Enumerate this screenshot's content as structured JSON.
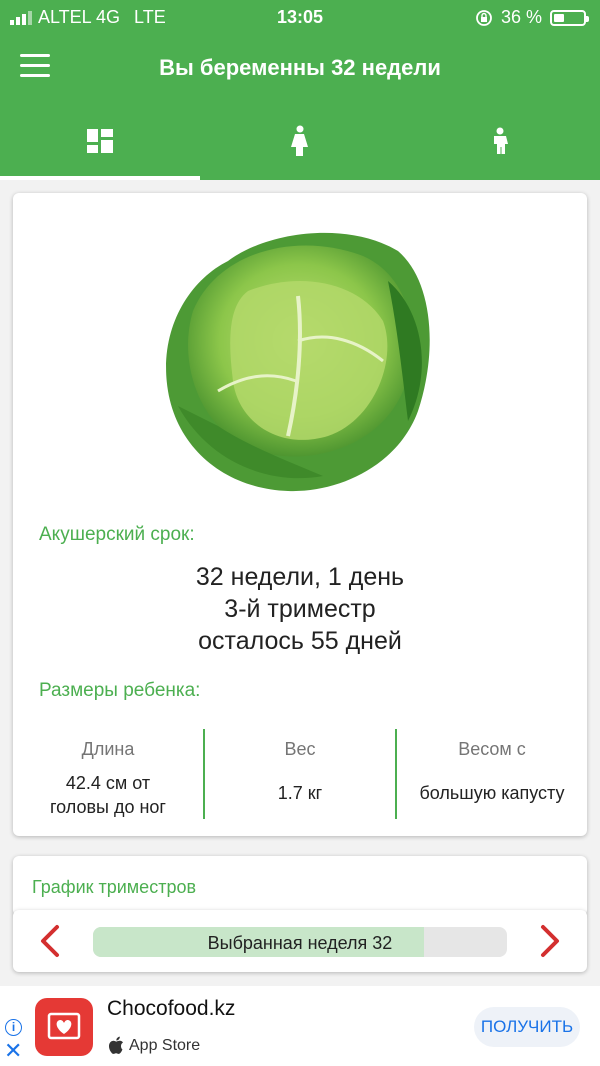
{
  "status_bar": {
    "carrier": "ALTEL 4G",
    "network": "LTE",
    "time": "13:05",
    "battery": "36 %",
    "battery_level": 0.36
  },
  "header": {
    "title": "Вы беременны 32 недели"
  },
  "tabs": [
    {
      "icon": "dashboard-icon",
      "active": true
    },
    {
      "icon": "pregnant-woman-icon",
      "active": false
    },
    {
      "icon": "child-icon",
      "active": false
    }
  ],
  "main_card": {
    "image": "cabbage-illustration",
    "term_label": "Акушерский срок:",
    "term_lines": [
      "32 недели, 1 день",
      "3-й триместр",
      "осталось 55 дней"
    ],
    "sizes_label": "Размеры ребенка:",
    "sizes": [
      {
        "header": "Длина",
        "value": "42.4 см от головы до ног"
      },
      {
        "header": "Вес",
        "value": "1.7 кг"
      },
      {
        "header": "Весом с",
        "value": "большую капусту"
      }
    ]
  },
  "trimester_card": {
    "label": "График триместров"
  },
  "week_nav": {
    "label": "Выбранная неделя 32",
    "progress": 0.8
  },
  "ad": {
    "app_name": "Chocofood.kz",
    "store": "App Store",
    "cta": "ПОЛУЧИТЬ"
  },
  "colors": {
    "primary": "#4caf50",
    "accent_red": "#d32f2f",
    "link_blue": "#1a73e8"
  }
}
